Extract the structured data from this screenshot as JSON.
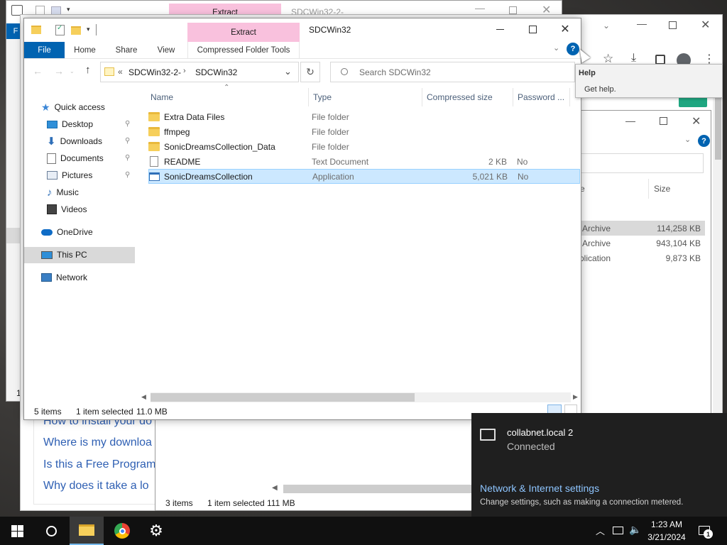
{
  "back_explorer": {
    "title": "SDCWin32-2-",
    "extract_tab": "Extract",
    "file_tab_partial": "F",
    "status_partial": "1 i"
  },
  "right_explorer": {
    "columns": {
      "type_partial": "e",
      "size": "Size"
    },
    "rows": [
      {
        "type": "Archive",
        "size": "114,258 KB"
      },
      {
        "type": "Archive",
        "size": "943,104 KB"
      },
      {
        "type": "plication",
        "size": "9,873 KB"
      }
    ],
    "status": {
      "items": "3 items",
      "selected": "1 item selected",
      "size": "111 MB"
    }
  },
  "browser_links": [
    "How to install your do",
    "Where is my downloa",
    "Is this a Free Program",
    "Why does it take a lo"
  ],
  "main_explorer": {
    "title": "SDCWin32",
    "context_tab": "Extract",
    "context_group": "Compressed Folder Tools",
    "ribbon_tabs": [
      "File",
      "Home",
      "Share",
      "View"
    ],
    "address": {
      "overflow": "«",
      "crumbs": [
        "SDCWin32-2-",
        "SDCWin32"
      ]
    },
    "search_placeholder": "Search SDCWin32",
    "columns": {
      "name": "Name",
      "type": "Type",
      "compressed_size": "Compressed size",
      "password": "Password ..."
    },
    "files": [
      {
        "name": "Extra Data Files",
        "type": "File folder",
        "size": "",
        "password": ""
      },
      {
        "name": "ffmpeg",
        "type": "File folder",
        "size": "",
        "password": ""
      },
      {
        "name": "SonicDreamsCollection_Data",
        "type": "File folder",
        "size": "",
        "password": ""
      },
      {
        "name": "README",
        "type": "Text Document",
        "size": "2 KB",
        "password": "No"
      },
      {
        "name": "SonicDreamsCollection",
        "type": "Application",
        "size": "5,021 KB",
        "password": "No"
      }
    ],
    "nav": {
      "quick_access": "Quick access",
      "desktop": "Desktop",
      "downloads": "Downloads",
      "documents": "Documents",
      "pictures": "Pictures",
      "music": "Music",
      "videos": "Videos",
      "onedrive": "OneDrive",
      "this_pc": "This PC",
      "network": "Network"
    },
    "status": {
      "items": "5 items",
      "selected": "1 item selected",
      "size": "11.0 MB"
    }
  },
  "tooltip": {
    "title": "Help",
    "body": "Get help."
  },
  "network_flyout": {
    "network_name": "collabnet.local 2",
    "network_status": "Connected",
    "settings_link": "Network & Internet settings",
    "settings_desc": "Change settings, such as making a connection metered."
  },
  "taskbar": {
    "time": "1:23 AM",
    "date": "3/21/2024",
    "notification_count": "1"
  },
  "colors": {
    "accent": "#0063b1",
    "selection": "#cce8ff",
    "context_tab": "#f9c1dd",
    "taskbar": "#101010",
    "flyout": "#1f1f1f"
  }
}
